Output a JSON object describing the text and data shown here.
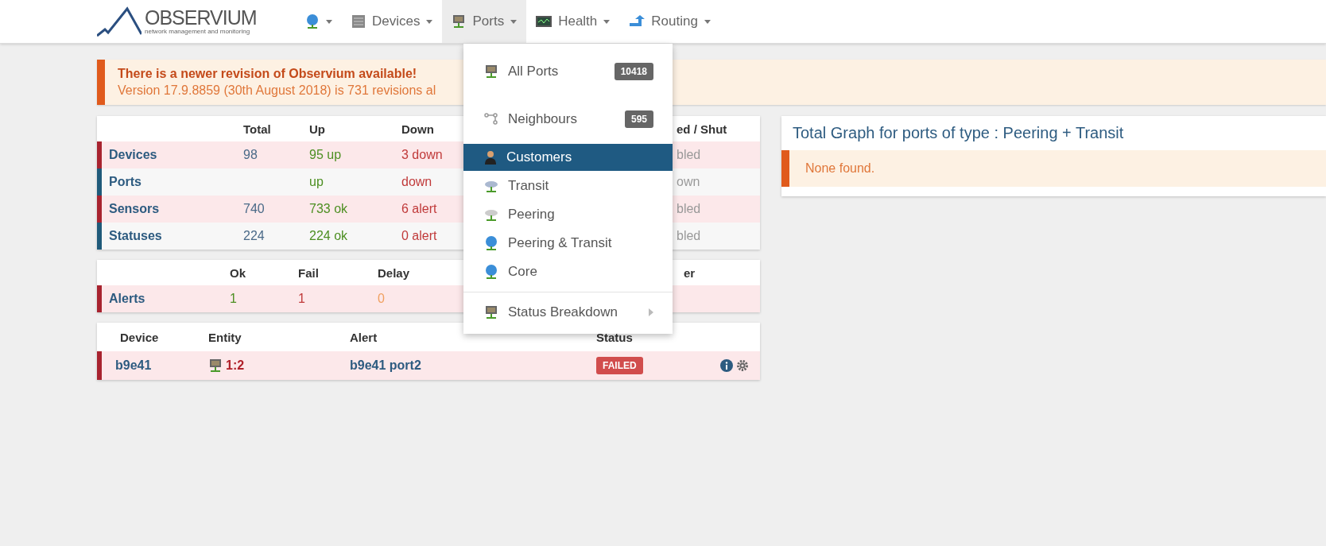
{
  "logo": {
    "name": "OBSERVIUM",
    "tagline": "network management and monitoring"
  },
  "nav": [
    {
      "selected": false
    },
    {
      "label": "Devices",
      "selected": false
    },
    {
      "label": "Ports",
      "selected": true
    },
    {
      "label": "Health",
      "selected": false
    },
    {
      "label": "Routing",
      "selected": false
    }
  ],
  "notice": {
    "title": "There is a newer revision of Observium available!",
    "text": "Version 17.9.8859 (30th August 2018) is 731 revisions al"
  },
  "summary": {
    "columns": [
      "",
      "Total",
      "Up",
      "Down",
      "ed / Shut"
    ],
    "rows": [
      {
        "name": "Devices",
        "color": "#a8232f",
        "total": "98",
        "up": "95 up",
        "down": "3 down",
        "column_5": "bled"
      },
      {
        "name": "Ports",
        "color": "#1f5a7a",
        "total": "",
        "up": "up",
        "down": "down",
        "column_5": "own"
      },
      {
        "name": "Sensors",
        "color": "#a8232f",
        "total": "740",
        "up": "733 ok",
        "down": "6 alert",
        "column_5": "bled"
      },
      {
        "name": "Statuses",
        "color": "#1f5a7a",
        "total": "224",
        "up": "224 ok",
        "down": "0 alert",
        "column_5": "bled"
      }
    ]
  },
  "alerts_summary": {
    "columns": [
      "",
      "Ok",
      "Fail",
      "Delay",
      "er"
    ],
    "rows": [
      {
        "name": "Alerts",
        "color": "#a8232f",
        "ok": "1",
        "fail": "1",
        "delay": "0"
      }
    ]
  },
  "alert_list": {
    "columns": [
      "Device",
      "Entity",
      "Alert",
      "Status"
    ],
    "rows": [
      {
        "device": "b9e41",
        "entity": "1:2",
        "alert": "b9e41 port2",
        "status": "FAILED"
      }
    ]
  },
  "ports_menu": [
    {
      "label": "All Ports",
      "badge": "10418",
      "selected": false,
      "submenu": false
    },
    {
      "label": "Neighbours",
      "badge": "595",
      "selected": false,
      "submenu": false
    },
    {
      "label": "Customers",
      "selected": true,
      "submenu": false
    },
    {
      "label": "Transit",
      "selected": false,
      "submenu": false
    },
    {
      "label": "Peering",
      "selected": false,
      "submenu": false
    },
    {
      "label": "Peering & Transit",
      "selected": false,
      "submenu": false
    },
    {
      "label": "Core",
      "selected": false,
      "submenu": false
    },
    {
      "label": "Status Breakdown",
      "selected": false,
      "submenu": true
    }
  ],
  "graph_panel": {
    "title": "Total Graph for ports of type : Peering + Transit",
    "message": "None found."
  }
}
